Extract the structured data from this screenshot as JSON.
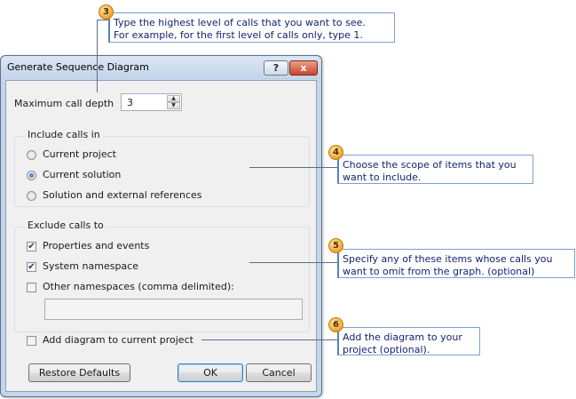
{
  "dialog": {
    "title": "Generate Sequence Diagram",
    "help_label": "?",
    "close_label": "x",
    "max_depth_label": "Maximum call depth",
    "max_depth_value": "3",
    "spin_up": "▲",
    "spin_down": "▼",
    "include_group": {
      "title": "Include calls in",
      "options": [
        {
          "label": "Current project",
          "selected": false
        },
        {
          "label": "Current solution",
          "selected": true
        },
        {
          "label": "Solution and external references",
          "selected": false
        }
      ]
    },
    "exclude_group": {
      "title": "Exclude calls to",
      "options": [
        {
          "label": "Properties and events",
          "checked": true
        },
        {
          "label": "System namespace",
          "checked": true
        },
        {
          "label": "Other namespaces (comma delimited):",
          "checked": false
        }
      ],
      "namespaces_value": ""
    },
    "add_diagram": {
      "label": "Add diagram to current project",
      "checked": false
    },
    "buttons": {
      "restore": "Restore Defaults",
      "ok": "OK",
      "cancel": "Cancel"
    },
    "check_mark": "✔"
  },
  "callouts": [
    {
      "number": "3",
      "line1": "Type the highest level of calls that you want to see.",
      "line2": "For example, for the first level of calls only, type 1."
    },
    {
      "number": "4",
      "line1": "Choose the scope of items that you",
      "line2": "want to include."
    },
    {
      "number": "5",
      "line1": "Specify any of these items whose calls you",
      "line2": "want to omit from the graph. (optional)"
    },
    {
      "number": "6",
      "line1": "Add the diagram to your",
      "line2": "project (optional)."
    }
  ],
  "colors": {
    "callout_text": "#101f70",
    "badge": "#f2a22a",
    "dialog_frame": "#c6d6ea"
  }
}
